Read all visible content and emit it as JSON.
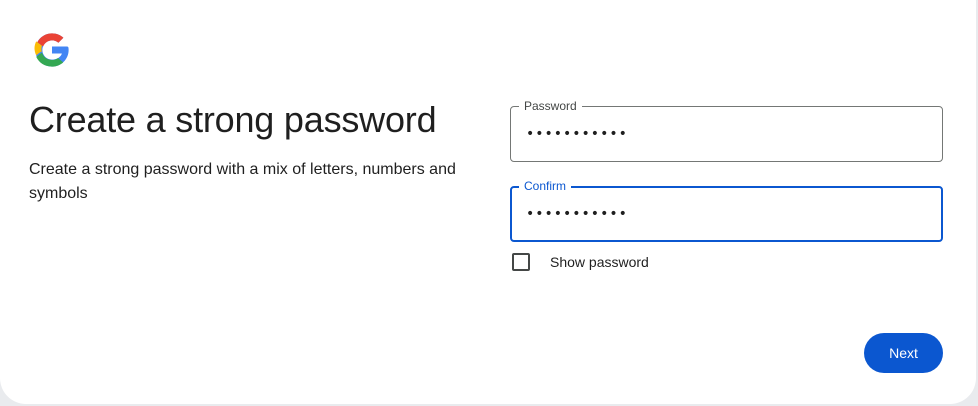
{
  "brand": {
    "logo_icon": "google-g-icon",
    "colors": {
      "blue": "#4285F4",
      "red": "#EA4335",
      "yellow": "#FBBC05",
      "green": "#34A853"
    }
  },
  "page": {
    "title": "Create a strong password",
    "subtitle": "Create a strong password with a mix of letters, numbers and symbols"
  },
  "form": {
    "password": {
      "label": "Password",
      "value": "•••••••••••"
    },
    "confirm": {
      "label": "Confirm",
      "value": "•••••••••••",
      "focused": true
    },
    "show_password": {
      "label": "Show password",
      "checked": false
    },
    "next_label": "Next"
  },
  "theme": {
    "accent": "#0b57d0",
    "text": "#1f1f1f",
    "outline": "#747775",
    "background": "#ffffff"
  }
}
